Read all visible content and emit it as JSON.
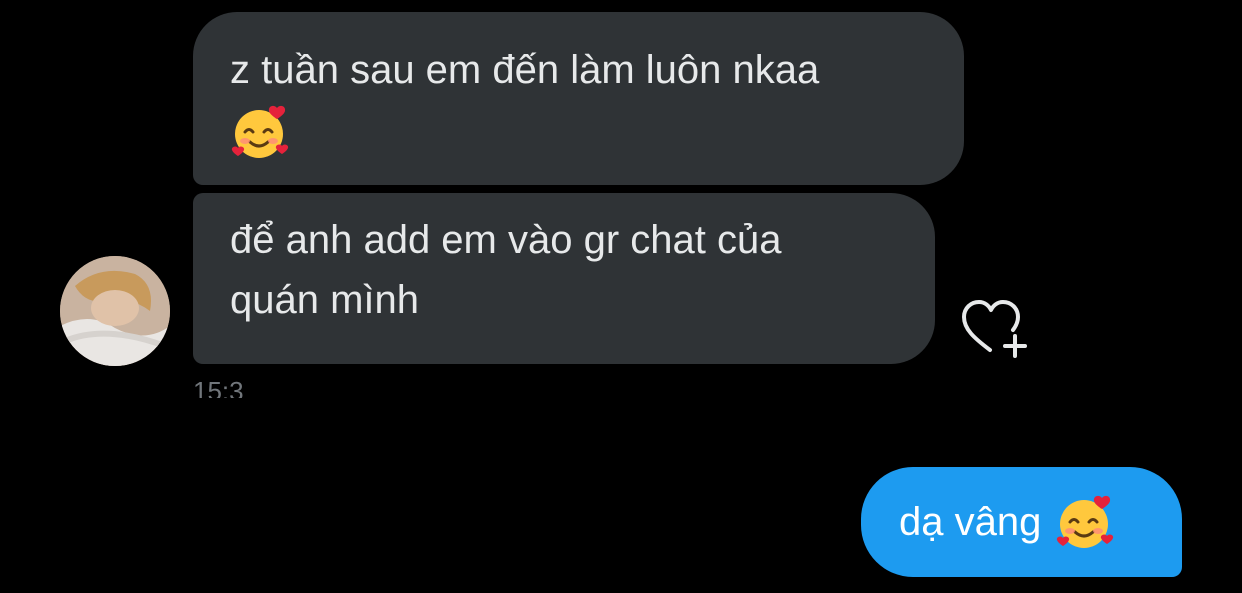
{
  "conversation": {
    "incoming": [
      {
        "text": "z tuần sau em đến làm luôn nkaa",
        "emoji": "smiling-face-with-hearts"
      },
      {
        "text_line1": "để anh add em vào gr chat của",
        "text_line2": "quán mình"
      }
    ],
    "timestamp": "15:3",
    "outgoing": [
      {
        "text": "dạ vâng",
        "emoji": "smiling-face-with-hearts"
      }
    ]
  },
  "colors": {
    "background": "#000000",
    "incoming_bubble": "#2f3336",
    "outgoing_bubble": "#1d9bf0",
    "text": "#e7e9ea",
    "icon": "#e7e9ea"
  },
  "icons": {
    "reaction": "heart-add-icon",
    "emoji": "smiling-face-with-hearts"
  }
}
